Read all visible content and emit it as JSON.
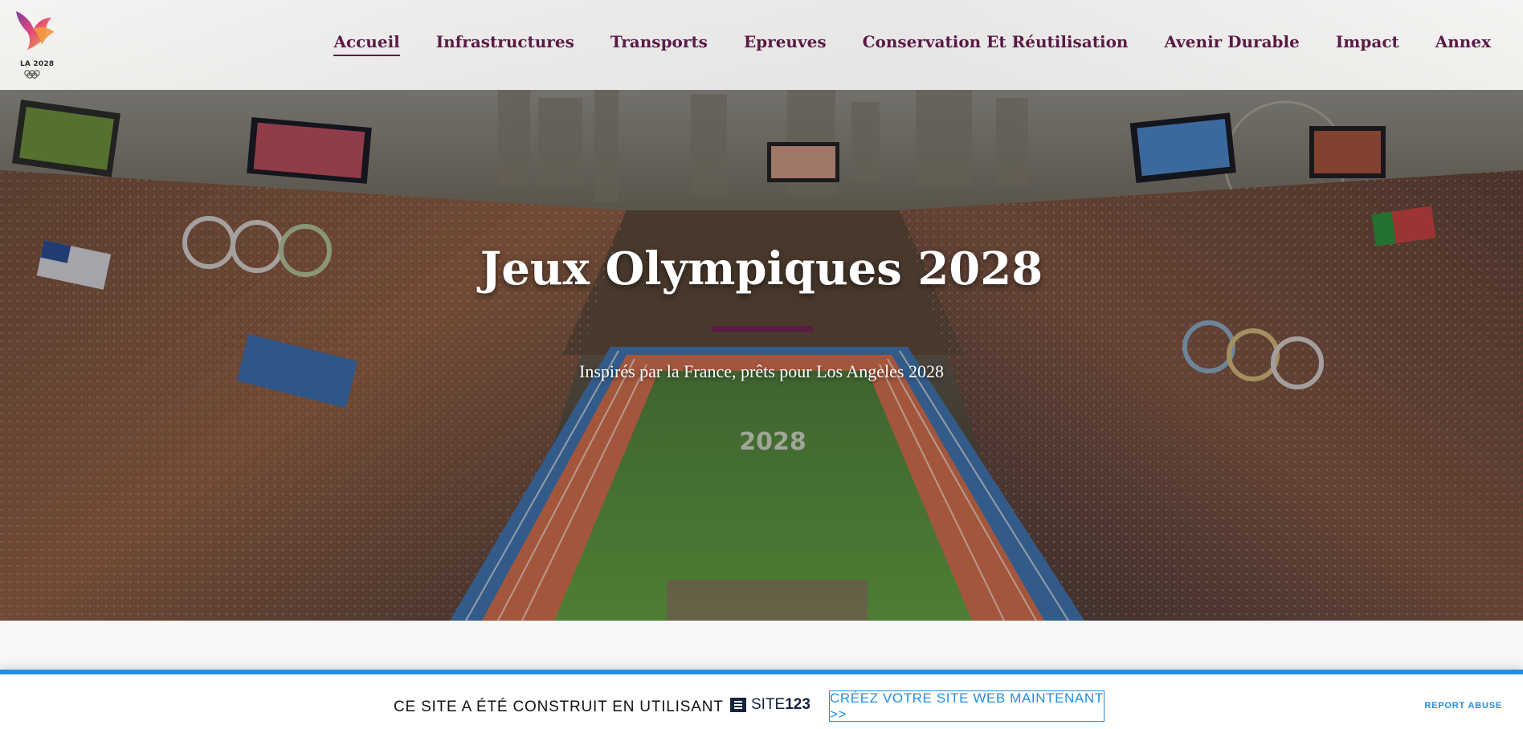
{
  "header": {
    "logo_text": "LA 2028",
    "nav": [
      {
        "label": "Accueil",
        "active": true
      },
      {
        "label": "Infrastructures"
      },
      {
        "label": "Transports"
      },
      {
        "label": "Epreuves"
      },
      {
        "label": "Conservation Et Réutilisation"
      },
      {
        "label": "Avenir Durable"
      },
      {
        "label": "Impact"
      },
      {
        "label": "Annex"
      }
    ]
  },
  "hero": {
    "title": "Jeux Olympiques 2028",
    "subtitle": "Inspirés par la France, prêts pour Los Angeles 2028",
    "accent_color": "#5a1a46"
  },
  "banner": {
    "text": "CE SITE A ÉTÉ CONSTRUIT EN UTILISANT",
    "brand_prefix": "SITE",
    "brand_suffix": "123",
    "cta_label": "CRÉEZ VOTRE SITE WEB MAINTENANT >>",
    "report_label": "REPORT ABUSE",
    "accent_color": "#1f8fe3"
  }
}
